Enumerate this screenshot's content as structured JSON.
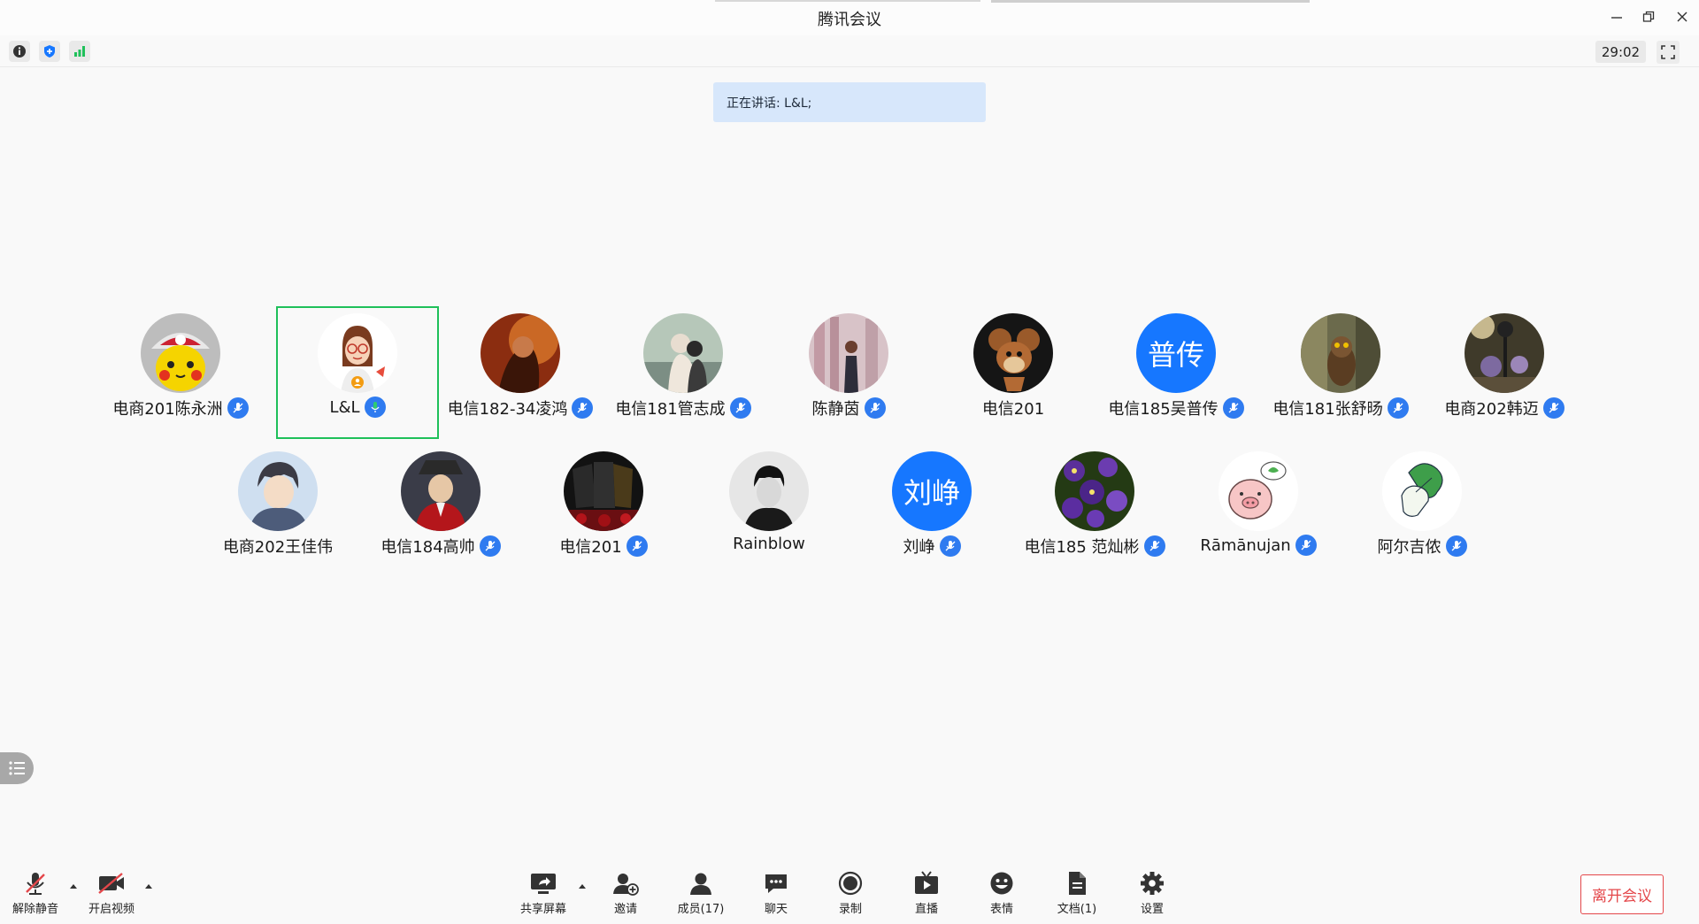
{
  "window": {
    "title": "腾讯会议",
    "timer": "29:02"
  },
  "speaking": {
    "text": "正在讲话: L&L;"
  },
  "participants": [
    {
      "name": "电商201陈永洲",
      "avatar": "pikachu-photo",
      "mic": "muted"
    },
    {
      "name": "L&L",
      "avatar": "cartoon-woman",
      "mic": "speaking",
      "active": true
    },
    {
      "name": "电信182-34凌鸿",
      "avatar": "photo-warm",
      "mic": "muted"
    },
    {
      "name": "电信181管志成",
      "avatar": "photo-couple",
      "mic": "muted"
    },
    {
      "name": "陈静茵",
      "avatar": "photo-street",
      "mic": "muted"
    },
    {
      "name": "电信201",
      "avatar": "jerry-mouse",
      "mic": "none"
    },
    {
      "name": "电信185吴普传",
      "avatar_text": "普传",
      "mic": "muted"
    },
    {
      "name": "电信181张舒旸",
      "avatar": "photo-owl",
      "mic": "muted"
    },
    {
      "name": "电商202韩迈",
      "avatar": "photo-lamp",
      "mic": "muted"
    },
    {
      "name": "电商202王佳伟",
      "avatar": "anime-boy",
      "mic": "none"
    },
    {
      "name": "电信184高帅",
      "avatar": "lupin-cartoon",
      "mic": "muted"
    },
    {
      "name": "电信201",
      "avatar": "jerseys-photo",
      "mic": "muted"
    },
    {
      "name": "Rainblow",
      "avatar": "portrait-bw",
      "mic": "none"
    },
    {
      "name": "刘峥",
      "avatar_text": "刘峥",
      "mic": "muted"
    },
    {
      "name": "电信185 范灿彬",
      "avatar": "purple-flowers",
      "mic": "muted"
    },
    {
      "name": "Rāmānujan",
      "avatar": "pig-cartoon",
      "mic": "muted"
    },
    {
      "name": "阿尔吉侬",
      "avatar": "cabbage-cartoon",
      "mic": "muted"
    }
  ],
  "toolbar": {
    "unmute": "解除静音",
    "start_video": "开启视频",
    "share_screen": "共享屏幕",
    "invite": "邀请",
    "members": "成员(17)",
    "chat": "聊天",
    "record": "录制",
    "live": "直播",
    "reactions": "表情",
    "docs": "文档(1)",
    "settings": "设置",
    "leave": "离开会议"
  },
  "colors": {
    "accent": "#1677ff",
    "active_border": "#1fc05a",
    "leave": "#e4474a",
    "banner": "#d7e7fb"
  }
}
